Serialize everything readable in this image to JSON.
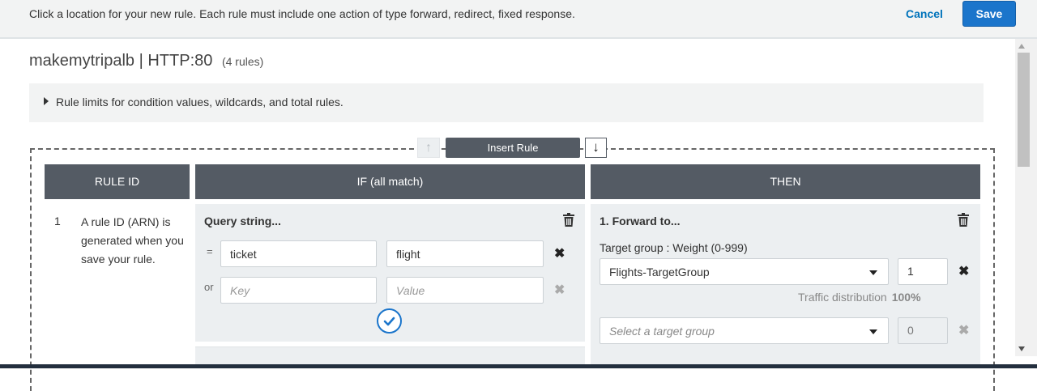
{
  "topbar": {
    "message": "Click a location for your new rule. Each rule must include one action of type forward, redirect, fixed response.",
    "cancel_label": "Cancel",
    "save_label": "Save"
  },
  "listener": {
    "title": "makemytripalb | HTTP:80",
    "rule_count": "(4 rules)"
  },
  "limits_label": "Rule limits for condition values, wildcards, and total rules.",
  "insert_rule_label": "Insert Rule",
  "columns": {
    "rule_id": "RULE ID",
    "if": "IF (all match)",
    "then": "THEN"
  },
  "rule": {
    "number": "1",
    "description": "A rule ID (ARN) is generated when you save your rule."
  },
  "condition": {
    "title": "Query string...",
    "rows": [
      {
        "operator": "=",
        "key": "ticket",
        "value": "flight"
      },
      {
        "operator": "or",
        "key_placeholder": "Key",
        "value_placeholder": "Value"
      }
    ]
  },
  "action": {
    "title": "1. Forward to...",
    "target_group_label": "Target group : Weight (0-999)",
    "target_groups": [
      {
        "name": "Flights-TargetGroup",
        "weight": "1"
      }
    ],
    "traffic_label": "Traffic distribution",
    "traffic_value": "100%",
    "new_target_placeholder": "Select a target group",
    "new_target_weight": "0"
  },
  "icons": {
    "trash": "trash-icon",
    "remove": "x-icon",
    "confirm": "check-circle-icon",
    "move_up": "arrow-up-icon",
    "move_down": "arrow-down-icon"
  },
  "colors": {
    "primary": "#1b75cb",
    "link": "#0073bb",
    "header": "#545b64",
    "panel": "#eceff1"
  }
}
